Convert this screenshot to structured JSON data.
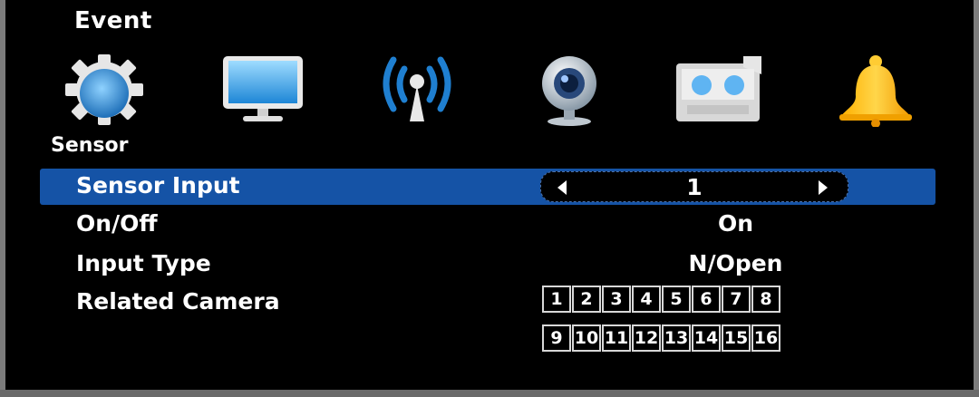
{
  "window": {
    "title": "Event"
  },
  "toolbar": {
    "icons": [
      "gear-icon",
      "monitor-icon",
      "antenna-icon",
      "webcam-icon",
      "recorder-icon",
      "bell-icon"
    ]
  },
  "section": {
    "title": "Sensor"
  },
  "settings": {
    "sensor_input": {
      "label": "Sensor Input",
      "value": "1"
    },
    "on_off": {
      "label": "On/Off",
      "value": "On"
    },
    "input_type": {
      "label": "Input Type",
      "value": "N/Open"
    },
    "related_camera": {
      "label": "Related Camera",
      "row1": [
        "1",
        "2",
        "3",
        "4",
        "5",
        "6",
        "7",
        "8"
      ],
      "row2": [
        "9",
        "10",
        "11",
        "12",
        "13",
        "14",
        "15",
        "16"
      ]
    }
  },
  "colors": {
    "selection": "#1553a6",
    "background": "#000000",
    "text": "#ffffff"
  }
}
